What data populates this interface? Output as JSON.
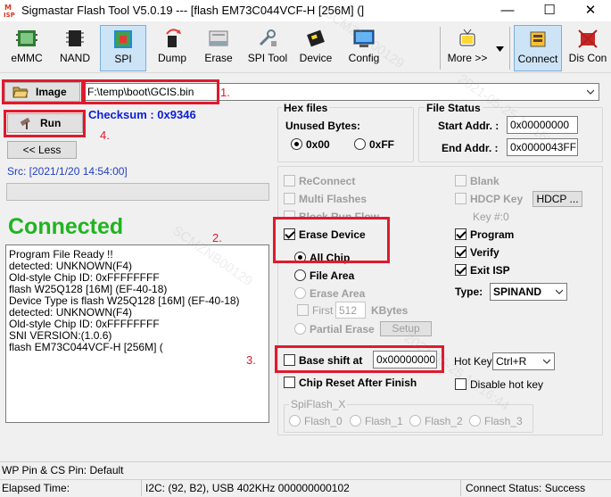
{
  "window": {
    "title": "Sigmastar Flash Tool V5.0.19 --- [flash EM73C044VCF-H [256M] (]",
    "minimize": "—",
    "maximize": "☐",
    "close": "✕"
  },
  "toolbar": {
    "emmc": "eMMC",
    "nand": "NAND",
    "spi": "SPI",
    "dump": "Dump",
    "erase": "Erase",
    "spi_tool": "SPI Tool",
    "device": "Device",
    "config": "Config",
    "more": "More >>",
    "connect": "Connect",
    "disconnect": "Dis Con"
  },
  "image": {
    "button_label": "Image",
    "path": "F:\\temp\\boot\\GCIS.bin"
  },
  "run": {
    "button_label": "Run",
    "checksum": "Checksum : 0x9346"
  },
  "less_button": "<< Less",
  "src": "Src: [2021/1/20 14:54:00]",
  "progress": 0,
  "connected_text": "Connected",
  "log_lines": [
    "Program File Ready !!",
    "detected: UNKNOWN(F4)",
    "Old-style Chip ID: 0xFFFFFFFF",
    "flash W25Q128 [16M] (EF-40-18)",
    "Device Type is flash W25Q128 [16M] (EF-40-18)",
    "detected: UNKNOWN(F4)",
    "Old-style Chip ID: 0xFFFFFFFF",
    "SNI VERSION:(1.0.6)",
    "flash EM73C044VCF-H [256M] ("
  ],
  "hex_files": {
    "title": "Hex files",
    "unused_bytes": "Unused Bytes:",
    "opt_00": "0x00",
    "opt_ff": "0xFF",
    "selected": "0x00"
  },
  "file_status": {
    "title": "File Status",
    "start_label": "Start Addr. :",
    "start_value": "0x00000000",
    "end_label": "End Addr. :",
    "end_value": "0x0000043FF"
  },
  "options": {
    "reconnect": "ReConnect",
    "multi_flashes": "Multi Flashes",
    "block_run_flow": "Block Run Flow",
    "erase_device": "Erase Device",
    "all_chip": "All Chip",
    "file_area": "File Area",
    "erase_area": "Erase Area",
    "first": "First",
    "first_value": "512",
    "kbytes": "KBytes",
    "partial_erase": "Partial Erase",
    "setup": "Setup",
    "blank": "Blank",
    "hdcp_key": "HDCP Key",
    "hdcp_button": "HDCP ...",
    "key_index": "Key #:0",
    "program": "Program",
    "verify": "Verify",
    "exit_isp": "Exit ISP",
    "type_label": "Type:",
    "type_value": "SPINAND",
    "base_shift": "Base shift at",
    "base_shift_value": "0x00000000",
    "hot_key_label": "Hot Key",
    "hot_key_value": "Ctrl+R",
    "chip_reset": "Chip Reset After Finish",
    "disable_hot_key": "Disable hot key"
  },
  "spiflash": {
    "title": "SpiFlash_X",
    "flash0": "Flash_0",
    "flash1": "Flash_1",
    "flash2": "Flash_2",
    "flash3": "Flash_3"
  },
  "annotations": {
    "a1": "1.",
    "a2": "2.",
    "a3": "3.",
    "a4": "4."
  },
  "status_bar": {
    "pins": "WP Pin & CS Pin: Default",
    "elapsed": "Elapsed Time:",
    "i2c": "I2C: (92, B2), USB  402KHz  000000000102",
    "connect_status": "Connect Status: Success"
  },
  "colors": {
    "connected": "#1fb51f",
    "checksum": "#0a1fd6",
    "annotation": "#e01a2e",
    "src_text": "#1f3fbf"
  },
  "watermark": {
    "text_a": "SCMZNB00129",
    "text_b": "2021-05-25  16:16:44"
  }
}
